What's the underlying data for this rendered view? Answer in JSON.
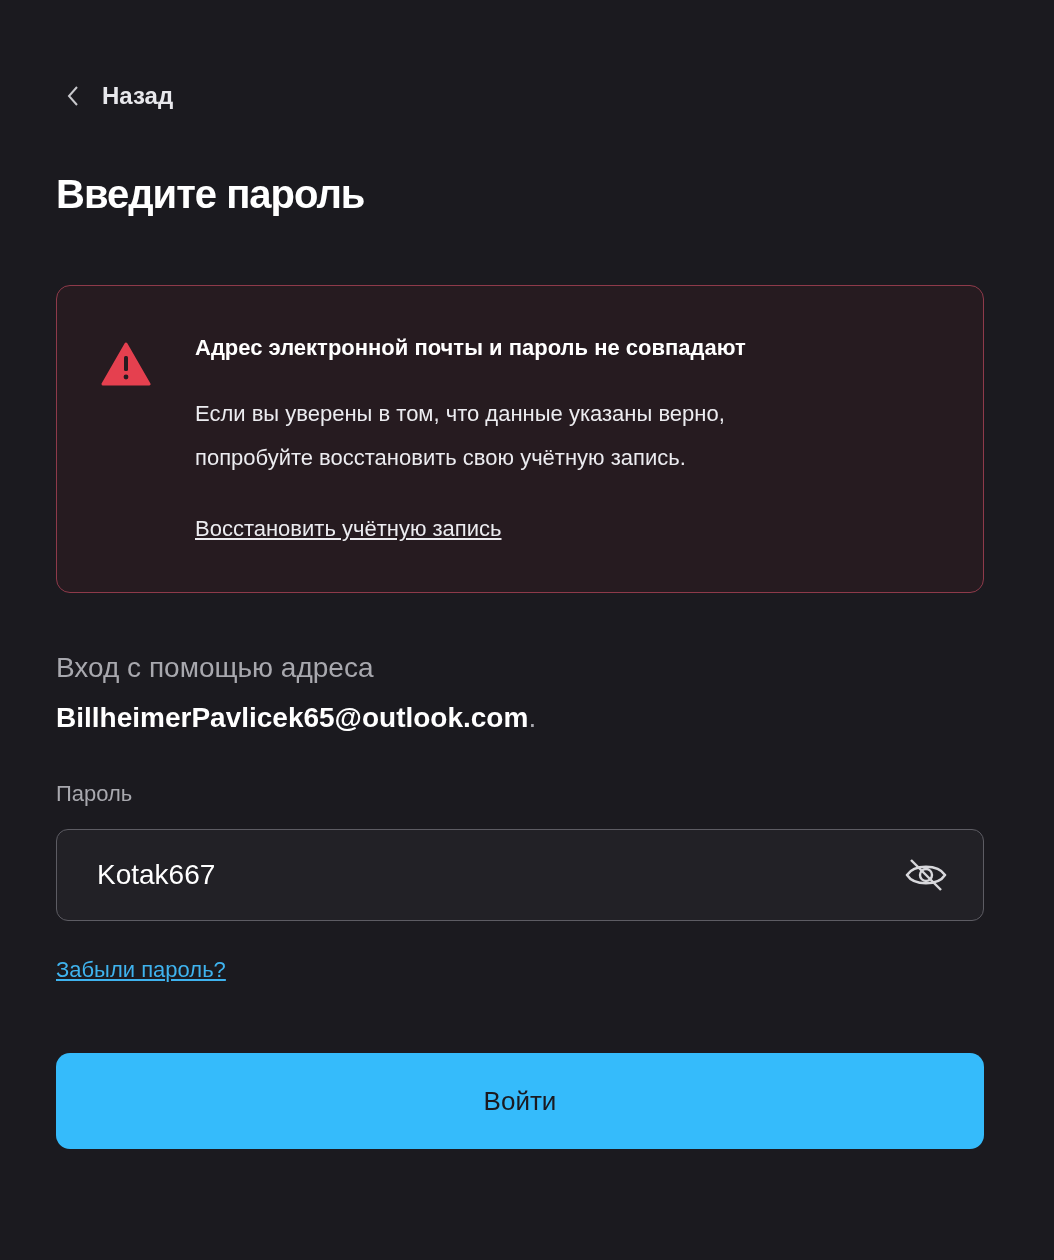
{
  "back": {
    "label": "Назад"
  },
  "title": "Введите пароль",
  "alert": {
    "kind": "error",
    "title": "Адрес электронной почты и пароль не совпадают",
    "message_lines": [
      "Если вы уверены в том, что данные указаны верно,",
      "попробуйте восстановить свою учётную запись."
    ],
    "link": "Восстановить учётную запись"
  },
  "signin_note": "Вход с помощью адреса **BillheimerPavlicek65@outlook.com**.",
  "password": {
    "label": "Пароль",
    "value": "Kotak667",
    "visible": true
  },
  "forgot_link": "Забыли пароль?",
  "submit_button": "Войти"
}
